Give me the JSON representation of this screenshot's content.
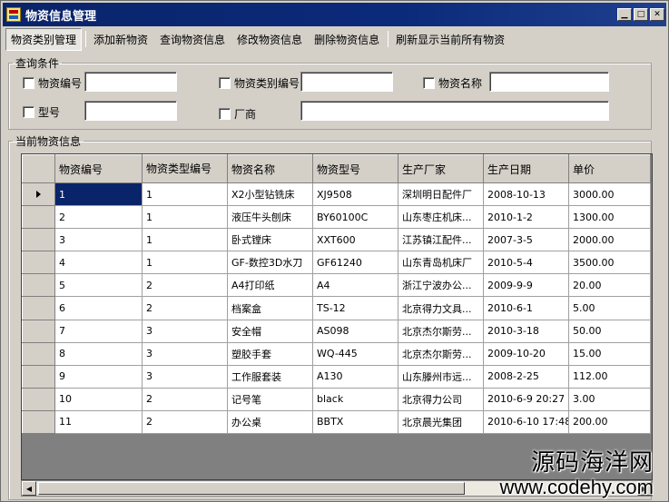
{
  "window": {
    "title": "物资信息管理"
  },
  "menu": [
    {
      "label": "物资类别管理",
      "active": true
    },
    {
      "label": "添加新物资"
    },
    {
      "label": "查询物资信息"
    },
    {
      "label": "修改物资信息"
    },
    {
      "label": "删除物资信息"
    },
    {
      "label": "刷新显示当前所有物资"
    }
  ],
  "query": {
    "legend": "查询条件",
    "fields": {
      "code": {
        "label": "物资编号",
        "value": ""
      },
      "type_code": {
        "label": "物资类别编号",
        "value": ""
      },
      "name": {
        "label": "物资名称",
        "value": ""
      },
      "model": {
        "label": "型号",
        "value": ""
      },
      "maker": {
        "label": "厂商",
        "value": ""
      }
    }
  },
  "results": {
    "legend": "当前物资信息",
    "columns": [
      "物资编号",
      "物资类型编号",
      "物资名称",
      "物资型号",
      "生产厂家",
      "生产日期",
      "单价"
    ],
    "rows": [
      [
        "1",
        "1",
        "X2小型钻铣床",
        "XJ9508",
        "深圳明日配件厂",
        "2008-10-13",
        "3000.00"
      ],
      [
        "2",
        "1",
        "液压牛头刨床",
        "BY60100C",
        "山东枣庄机床...",
        "2010-1-2",
        "1300.00"
      ],
      [
        "3",
        "1",
        "卧式镗床",
        "XXT600",
        "江苏镇江配件...",
        "2007-3-5",
        "2000.00"
      ],
      [
        "4",
        "1",
        "GF-数控3D水刀",
        "GF61240",
        "山东青岛机床厂",
        "2010-5-4",
        "3500.00"
      ],
      [
        "5",
        "2",
        "A4打印纸",
        "A4",
        "浙江宁波办公...",
        "2009-9-9",
        "20.00"
      ],
      [
        "6",
        "2",
        "档案盒",
        "TS-12",
        "北京得力文具...",
        "2010-6-1",
        "5.00"
      ],
      [
        "7",
        "3",
        "安全帽",
        "AS098",
        "北京杰尔斯劳...",
        "2010-3-18",
        "50.00"
      ],
      [
        "8",
        "3",
        "塑胶手套",
        "WQ-445",
        "北京杰尔斯劳...",
        "2009-10-20",
        "15.00"
      ],
      [
        "9",
        "3",
        "工作服套装",
        "A130",
        "山东滕州市远...",
        "2008-2-25",
        "112.00"
      ],
      [
        "10",
        "2",
        "记号笔",
        "black",
        "北京得力公司",
        "2010-6-9 20:27",
        "3.00"
      ],
      [
        "11",
        "2",
        "办公桌",
        "BBTX",
        "北京晨光集团",
        "2010-6-10 17:48",
        "200.00"
      ]
    ],
    "selected_row": 0
  },
  "watermark": {
    "name": "源码海洋网",
    "url": "www.codehy.com"
  },
  "colors": {
    "titlebar": "#0a246a",
    "selection": "#0a246a",
    "face": "#d4d0c8"
  },
  "icons": {
    "arrow": "▸"
  }
}
